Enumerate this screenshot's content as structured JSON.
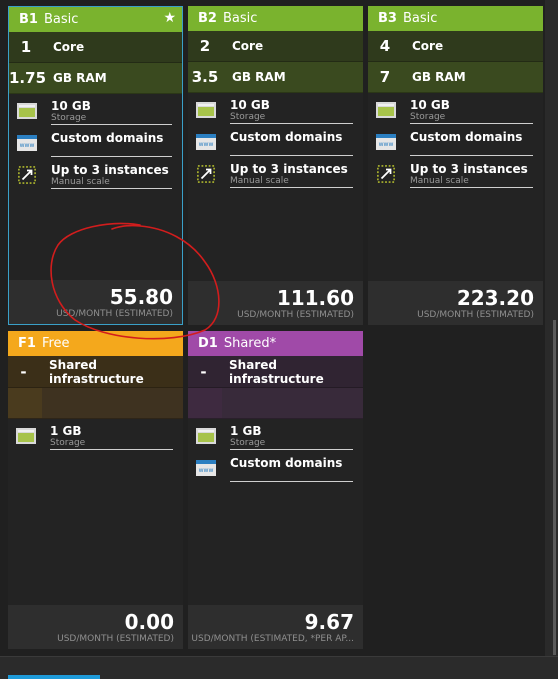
{
  "tiles": {
    "b1": {
      "code": "B1",
      "tier": "Basic",
      "star": "★",
      "core_num": "1",
      "core_label": "Core",
      "ram_num": "1.75",
      "ram_label": "GB RAM",
      "storage": "10 GB",
      "storage_sub": "Storage",
      "domains": "Custom domains",
      "instances": "Up to 3 instances",
      "instances_sub": "Manual scale",
      "price": "55.80",
      "unit": "USD/MONTH (ESTIMATED)"
    },
    "b2": {
      "code": "B2",
      "tier": "Basic",
      "core_num": "2",
      "core_label": "Core",
      "ram_num": "3.5",
      "ram_label": "GB RAM",
      "storage": "10 GB",
      "storage_sub": "Storage",
      "domains": "Custom domains",
      "instances": "Up to 3 instances",
      "instances_sub": "Manual scale",
      "price": "111.60",
      "unit": "USD/MONTH (ESTIMATED)"
    },
    "b3": {
      "code": "B3",
      "tier": "Basic",
      "core_num": "4",
      "core_label": "Core",
      "ram_num": "7",
      "ram_label": "GB RAM",
      "storage": "10 GB",
      "storage_sub": "Storage",
      "domains": "Custom domains",
      "instances": "Up to 3 instances",
      "instances_sub": "Manual scale",
      "price": "223.20",
      "unit": "USD/MONTH (ESTIMATED)"
    },
    "f1": {
      "code": "F1",
      "tier": "Free",
      "infra_num": "-",
      "infra_label": "Shared infrastructure",
      "storage": "1 GB",
      "storage_sub": "Storage",
      "price": "0.00",
      "unit": "USD/MONTH (ESTIMATED)"
    },
    "d1": {
      "code": "D1",
      "tier": "Shared*",
      "infra_num": "-",
      "infra_label": "Shared infrastructure",
      "storage": "1 GB",
      "storage_sub": "Storage",
      "domains": "Custom domains",
      "price": "9.67",
      "unit": "USD/MONTH (ESTIMATED, *PER AP..."
    }
  },
  "colors": {
    "basic_header": "#7ab32e",
    "basic_row": "#3a4a1f",
    "free_header": "#f4a81c",
    "free_row": "#4a3b1e",
    "shared_header": "#a04aa8",
    "shared_row": "#3e2a40",
    "selection_border": "#3aa0c8",
    "annotation_red": "#d21d1d"
  },
  "icons": {
    "storage": "storage-icon",
    "domains": "www-icon",
    "instances": "scale-icon",
    "star": "star-icon"
  }
}
